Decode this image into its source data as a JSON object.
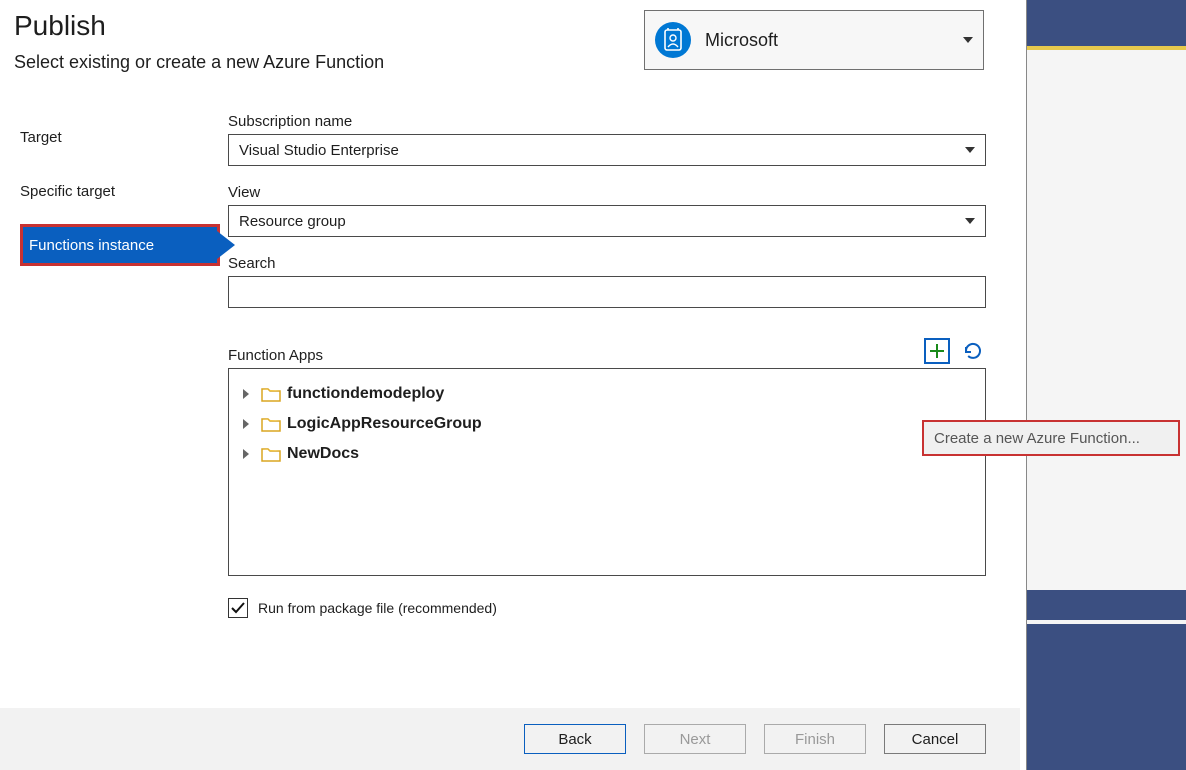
{
  "header": {
    "title": "Publish",
    "subtitle": "Select existing or create a new Azure Function"
  },
  "account": {
    "label": "Microsoft"
  },
  "sidebar": {
    "items": [
      {
        "label": "Target"
      },
      {
        "label": "Specific target"
      },
      {
        "label": "Functions instance"
      }
    ],
    "selected_index": 2
  },
  "fields": {
    "subscription_label": "Subscription name",
    "subscription_value": "Visual Studio Enterprise",
    "view_label": "View",
    "view_value": "Resource group",
    "search_label": "Search",
    "search_value": "",
    "functionapps_label": "Function Apps"
  },
  "tree": {
    "items": [
      {
        "name": "functiondemodeploy"
      },
      {
        "name": "LogicAppResourceGroup"
      },
      {
        "name": "NewDocs"
      }
    ]
  },
  "checkbox": {
    "label": "Run from package file (recommended)",
    "checked": true
  },
  "tooltip": {
    "text": "Create a new Azure Function..."
  },
  "buttons": {
    "back": "Back",
    "next": "Next",
    "finish": "Finish",
    "cancel": "Cancel"
  }
}
